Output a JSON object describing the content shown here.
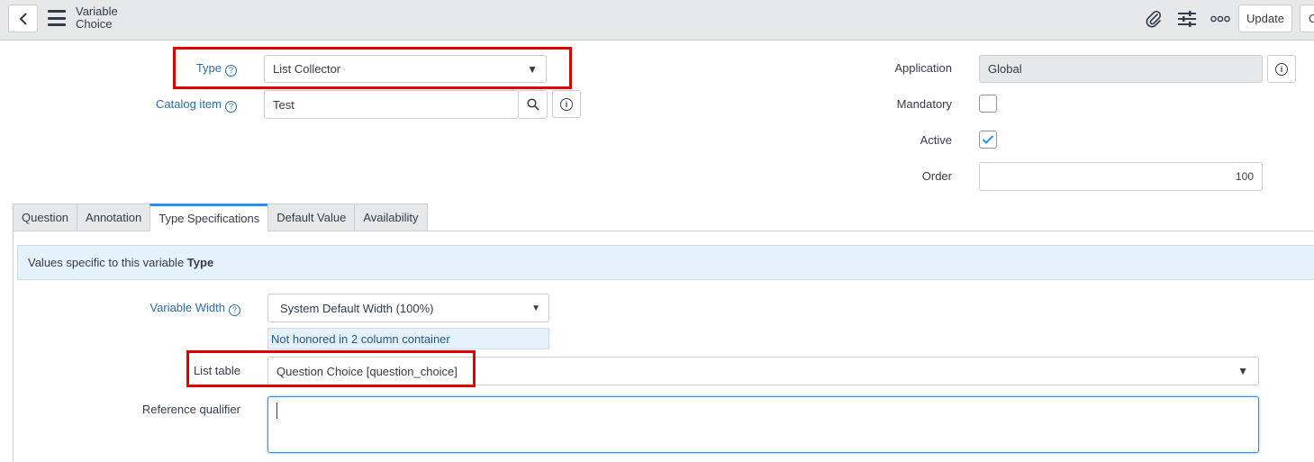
{
  "header": {
    "title_line1": "Variable",
    "title_line2": "Choice",
    "update_label": "Update",
    "cut_label": "C"
  },
  "icons": {
    "back": "chevron-left-icon",
    "menu": "hamburger-menu-icon",
    "attachment": "paperclip-icon",
    "settings": "sliders-icon",
    "more": "more-options-icon",
    "help": "question-circle-icon",
    "search": "search-icon",
    "info": "info-icon",
    "check": "check-icon"
  },
  "form": {
    "type": {
      "label": "Type",
      "value": "List Collector"
    },
    "catalog_item": {
      "label": "Catalog item",
      "value": "Test"
    },
    "application": {
      "label": "Application",
      "value": "Global"
    },
    "mandatory": {
      "label": "Mandatory",
      "checked": false
    },
    "active": {
      "label": "Active",
      "checked": true
    },
    "order": {
      "label": "Order",
      "value": "100"
    }
  },
  "tabs": [
    {
      "label": "Question",
      "active": false
    },
    {
      "label": "Annotation",
      "active": false
    },
    {
      "label": "Type Specifications",
      "active": true
    },
    {
      "label": "Default Value",
      "active": false
    },
    {
      "label": "Availability",
      "active": false
    }
  ],
  "type_specs": {
    "banner_prefix": "Values specific to this variable ",
    "banner_bold": "Type",
    "variable_width": {
      "label": "Variable Width",
      "value": "System Default Width (100%)"
    },
    "width_note": "Not honored in 2 column container",
    "list_table": {
      "label": "List table",
      "value": "Question Choice [question_choice]"
    },
    "reference_qualifier": {
      "label": "Reference qualifier",
      "value": ""
    }
  },
  "colors": {
    "highlight": "#e00000",
    "link": "#2e6da4",
    "tab_active_accent": "#278efc",
    "header_bg": "#e6e8ea",
    "banner_bg": "#e5f1fb"
  }
}
